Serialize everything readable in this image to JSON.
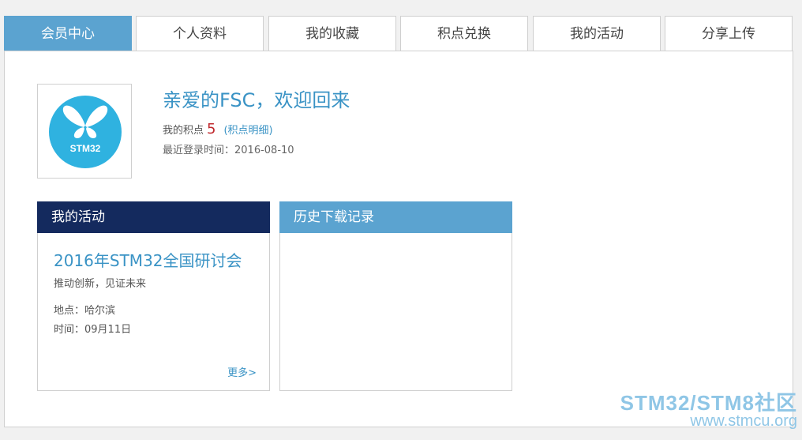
{
  "tabs": [
    {
      "label": "会员中心",
      "active": true
    },
    {
      "label": "个人资料",
      "active": false
    },
    {
      "label": "我的收藏",
      "active": false
    },
    {
      "label": "积点兑换",
      "active": false
    },
    {
      "label": "我的活动",
      "active": false
    },
    {
      "label": "分享上传",
      "active": false
    }
  ],
  "profile": {
    "avatar_text": "STM32",
    "welcome": "亲爱的FSC，欢迎回来",
    "points_label": "我的积点",
    "points_value": "5",
    "points_link": "(积点明细)",
    "last_login": "最近登录时间：2016-08-10"
  },
  "activity": {
    "header": "我的活动",
    "title": "2016年STM32全国研讨会",
    "subtitle": "推动创新，见证未来",
    "location": "地点：哈尔滨",
    "time": "时间：09月11日",
    "more": "更多>"
  },
  "history": {
    "header": "历史下载记录"
  },
  "watermark": {
    "line1": "STM32/STM8社区",
    "line2": "www.stmcu.org"
  },
  "colors": {
    "tab_active": "#5ba3d0",
    "activity_header": "#142a5e",
    "history_header": "#5ba3d0",
    "link": "#3a93c5",
    "points": "#c0282d"
  }
}
